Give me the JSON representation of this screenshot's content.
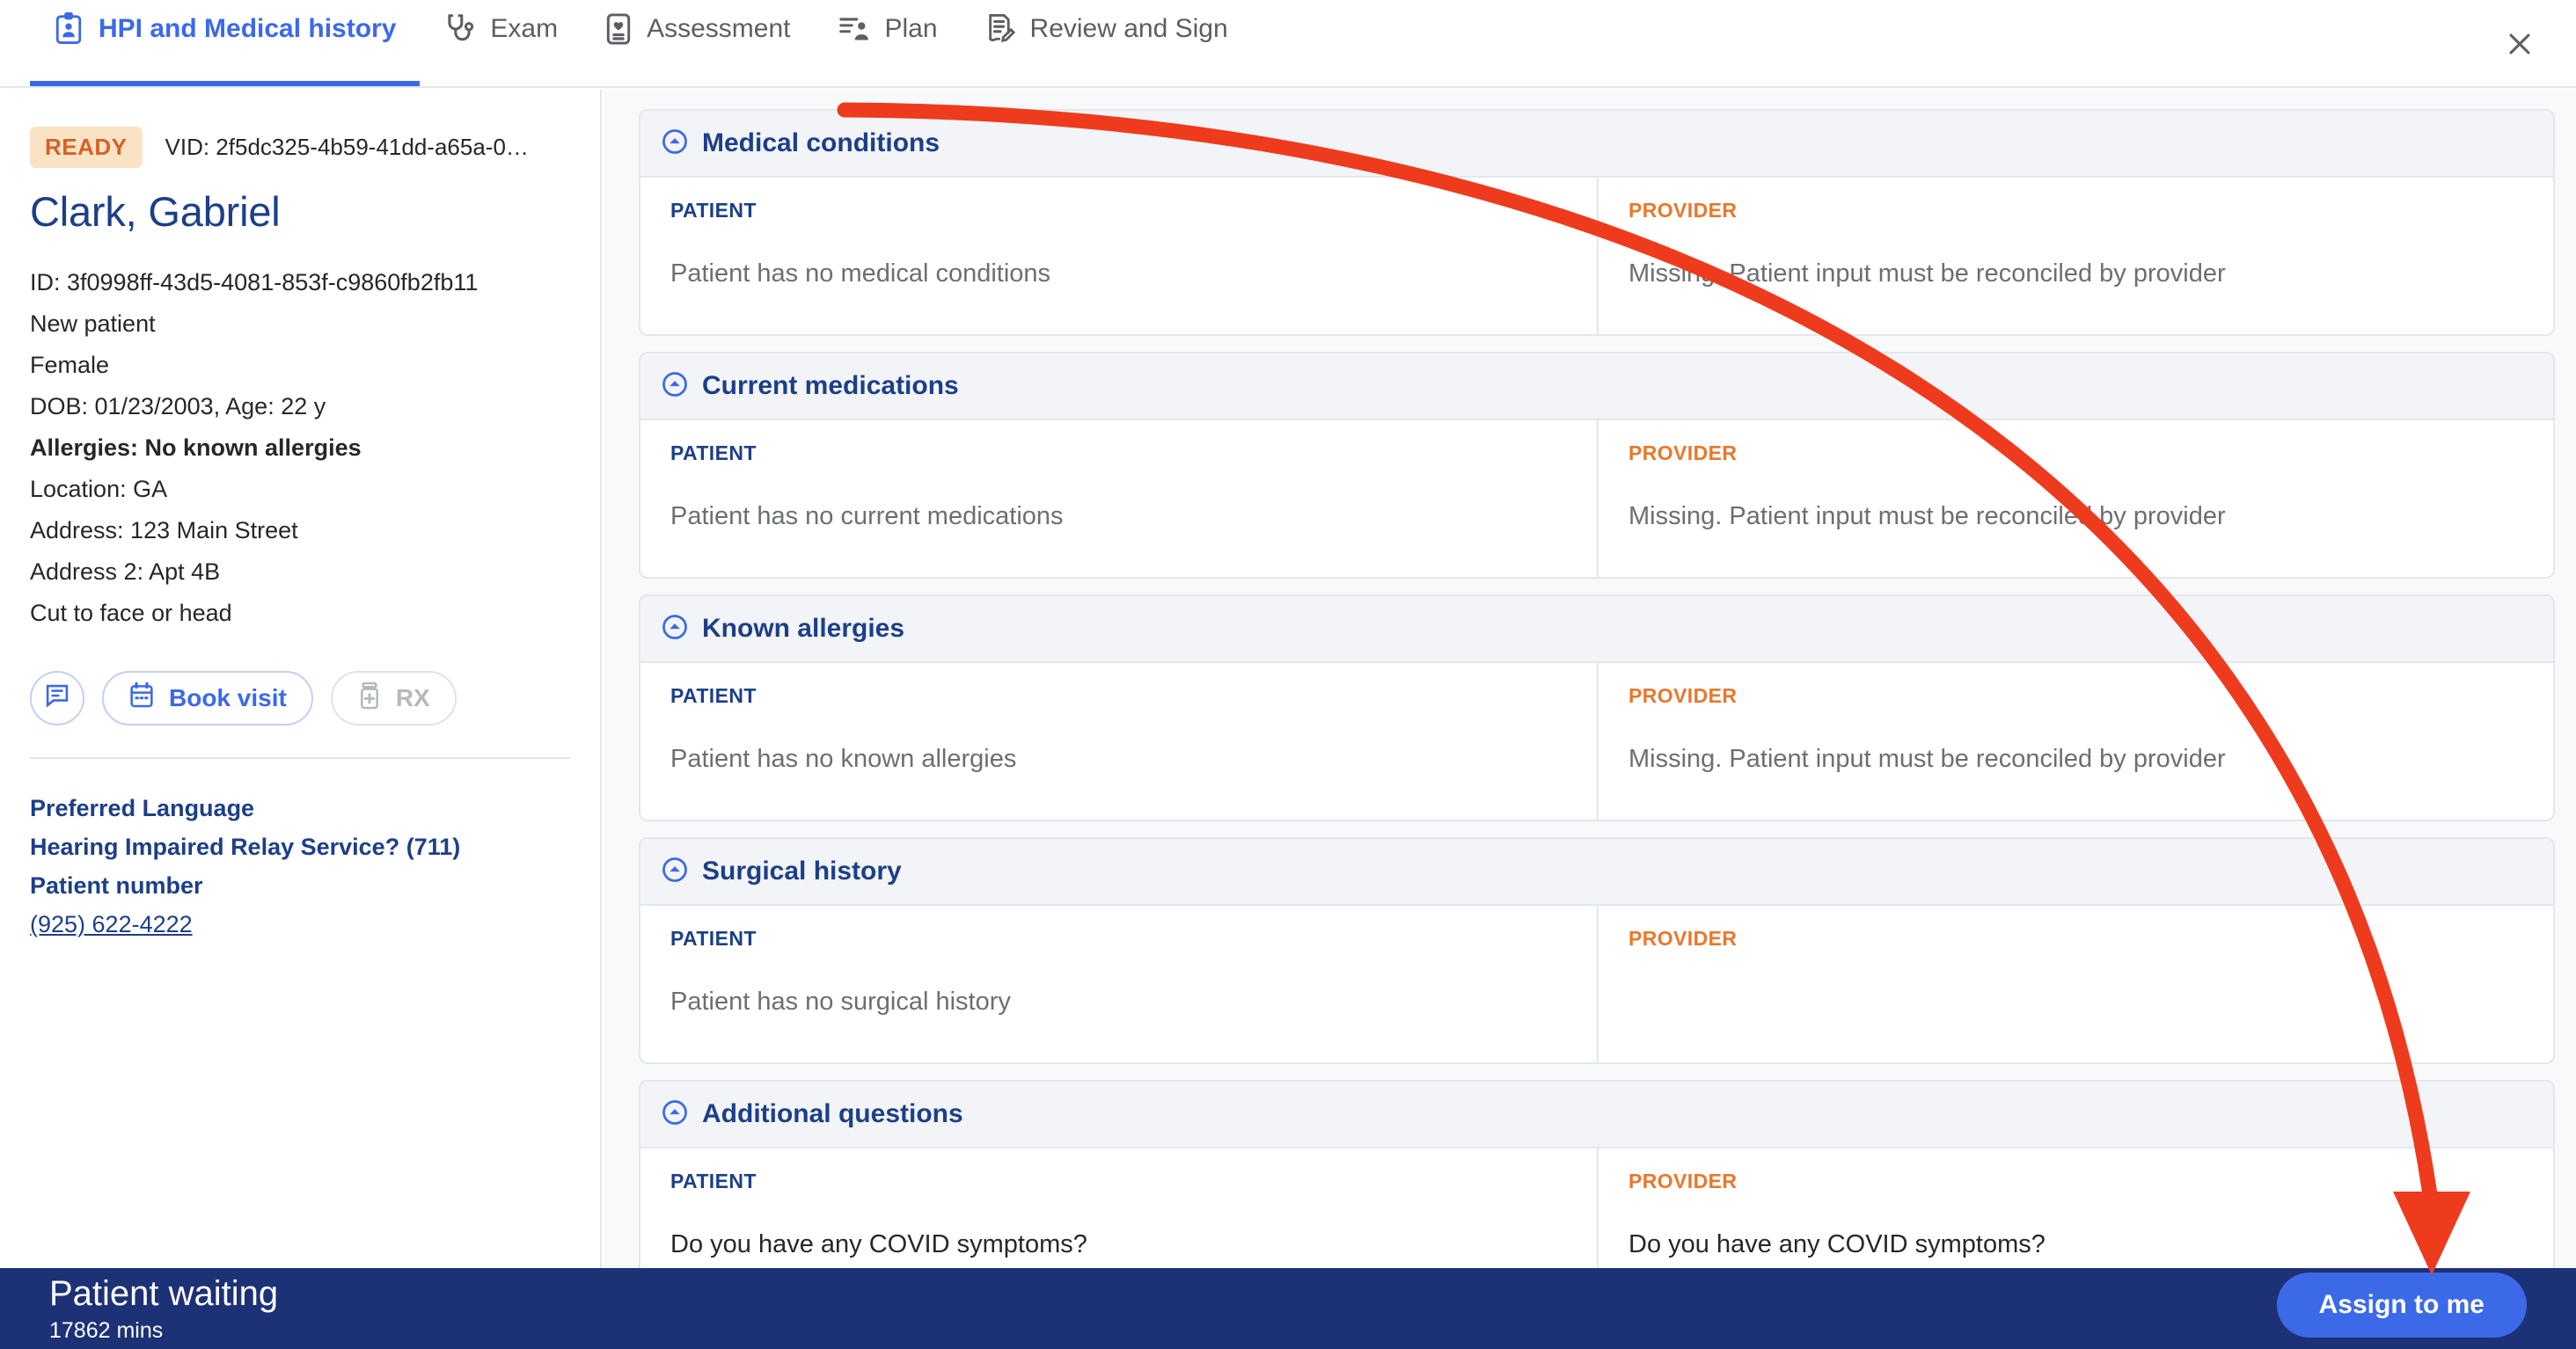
{
  "tabs": [
    {
      "label": "HPI and Medical history",
      "icon": "clipboard-person-icon",
      "active": true
    },
    {
      "label": "Exam",
      "icon": "stethoscope-icon",
      "active": false
    },
    {
      "label": "Assessment",
      "icon": "heart-monitor-icon",
      "active": false
    },
    {
      "label": "Plan",
      "icon": "plan-list-icon",
      "active": false
    },
    {
      "label": "Review and Sign",
      "icon": "document-pen-icon",
      "active": false
    }
  ],
  "window": {
    "close_label": "×"
  },
  "sidebar": {
    "status_badge": "READY",
    "vid": "VID: 2f5dc325-4b59-41dd-a65a-0…",
    "patient_name": "Clark, Gabriel",
    "details": [
      {
        "text": "ID: 3f0998ff-43d5-4081-853f-c9860fb2fb11",
        "bold": false
      },
      {
        "text": "New patient",
        "bold": false
      },
      {
        "text": "Female",
        "bold": false
      },
      {
        "text": "DOB: 01/23/2003, Age: 22 y",
        "bold": false
      },
      {
        "text": "Allergies: No known allergies",
        "bold": true
      },
      {
        "text": "Location: GA",
        "bold": false
      },
      {
        "text": "Address: 123 Main Street",
        "bold": false
      },
      {
        "text": "Address 2: Apt 4B",
        "bold": false
      },
      {
        "text": "Cut to face or head",
        "bold": false
      }
    ],
    "buttons": {
      "message_icon": "chat-bubble-icon",
      "book_visit": "Book visit",
      "book_visit_icon": "calendar-icon",
      "rx": "RX",
      "rx_icon": "pill-bottle-icon"
    },
    "links": [
      {
        "label": "Preferred Language",
        "type": "link"
      },
      {
        "label": "Hearing Impaired Relay Service? (711)",
        "type": "link"
      },
      {
        "label": "Patient number",
        "type": "link"
      },
      {
        "label": "(925) 622-4222",
        "type": "phone"
      }
    ]
  },
  "main": {
    "column_headers": {
      "patient": "PATIENT",
      "provider": "PROVIDER"
    },
    "sections": [
      {
        "title": "Medical conditions",
        "patient_value": "Patient has no medical conditions",
        "provider_value": "Missing. Patient input must be reconciled by provider",
        "dark": false
      },
      {
        "title": "Current medications",
        "patient_value": "Patient has no current medications",
        "provider_value": "Missing. Patient input must be reconciled by provider",
        "dark": false
      },
      {
        "title": "Known allergies",
        "patient_value": "Patient has no known allergies",
        "provider_value": "Missing. Patient input must be reconciled by provider",
        "dark": false
      },
      {
        "title": "Surgical history",
        "patient_value": "Patient has no surgical history",
        "provider_value": "",
        "dark": false
      },
      {
        "title": "Additional questions",
        "patient_value": "Do you have any COVID symptoms?",
        "provider_value": "Do you have any COVID symptoms?",
        "dark": true
      }
    ]
  },
  "bottom_bar": {
    "title": "Patient waiting",
    "subtitle": "17862 mins",
    "assign_label": "Assign to me"
  },
  "colors": {
    "accent_blue": "#3b69e8",
    "deep_navy": "#1d3f87",
    "bar_navy": "#1d3177",
    "provider_orange": "#e8782b",
    "badge_bg": "#fae3c4",
    "badge_text": "#d4622a",
    "annotation_red": "#ee3b1e"
  }
}
